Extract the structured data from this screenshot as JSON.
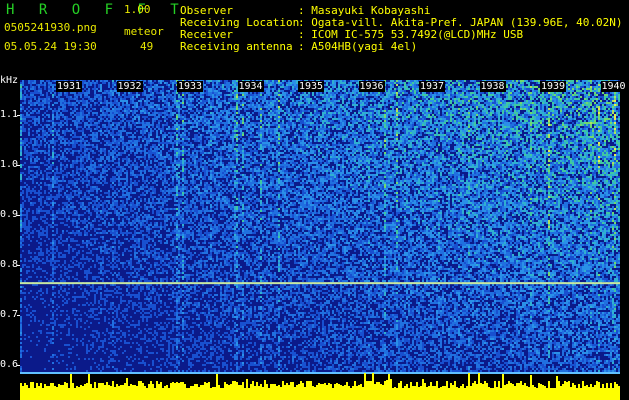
{
  "header": {
    "brand": "H R O F F T",
    "version": "1.00",
    "filename": "0505241930.png",
    "meteor_label": "meteor",
    "datetime": "05.05.24 19:30",
    "meteor_count": "49"
  },
  "info": [
    {
      "key": "Observer",
      "value": ": Masayuki Kobayashi"
    },
    {
      "key": "Receiving Location",
      "value": ": Ogata-vill. Akita-Pref. JAPAN (139.96E, 40.02N)"
    },
    {
      "key": "Receiver",
      "value": ": ICOM IC-575 53.7492(@LCD)MHz USB"
    },
    {
      "key": "Receiving antenna",
      "value": ": A504HB(yagi 4el)"
    }
  ],
  "axis": {
    "unit": "kHz",
    "y_ticks": [
      "1.1",
      "1.0",
      "0.9",
      "0.8",
      "0.7",
      "0.6"
    ],
    "y_values": [
      1.1,
      1.0,
      0.9,
      0.8,
      0.7,
      0.6
    ],
    "ylim": [
      0.585,
      1.17
    ],
    "minute_labels": [
      "1931",
      "1932",
      "1933",
      "1934",
      "1935",
      "1936",
      "1937",
      "1938",
      "1939",
      "1940"
    ]
  },
  "colors": {
    "background": "#000000",
    "brand": "#25d025",
    "text": "#ffff00",
    "spectrogram_base": "#0b1a8a",
    "signal_line": "#c8e8a0",
    "level_bars": "#ffff00"
  },
  "carrier_khz": 0.765
}
